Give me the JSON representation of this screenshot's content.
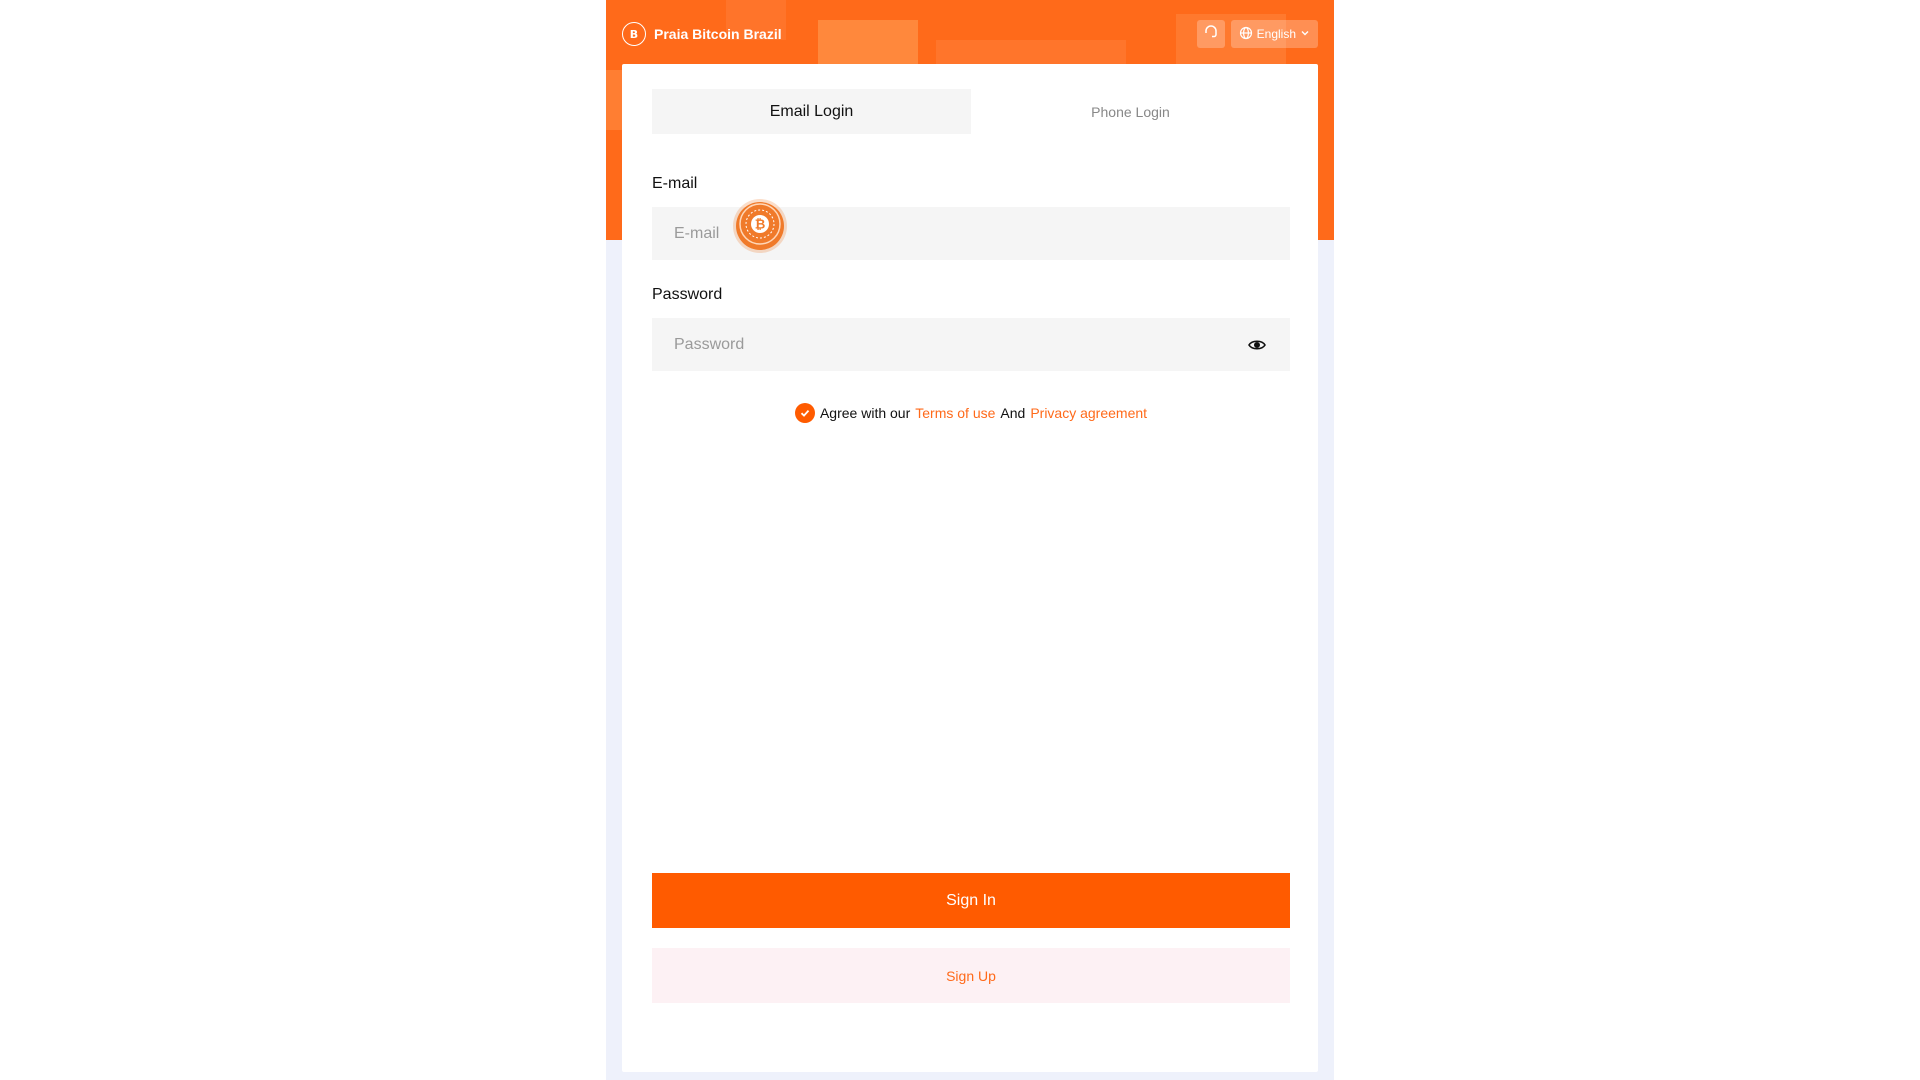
{
  "header": {
    "brand_name": "Praia Bitcoin Brazil",
    "brand_icon": "bitcoin-logo-icon",
    "support_icon": "headset-icon",
    "language_icon": "globe-icon",
    "language_label": "English",
    "language_chevron": "chevron-down-icon"
  },
  "tabs": [
    {
      "label": "Email Login",
      "active": true
    },
    {
      "label": "Phone Login",
      "active": false
    }
  ],
  "form": {
    "email_label": "E-mail",
    "email_placeholder": "E-mail",
    "email_value": "",
    "password_label": "Password",
    "password_placeholder": "Password",
    "password_value": "",
    "password_toggle_icon": "eye-icon"
  },
  "agreement": {
    "checked": true,
    "prefix": "Agree with our",
    "terms_label": "Terms of use",
    "conjunction": "And",
    "privacy_label": "Privacy agreement"
  },
  "actions": {
    "sign_in_label": "Sign In",
    "sign_up_label": "Sign Up"
  },
  "colors": {
    "accent": "#ff5b00",
    "hero": "#ff6a1a",
    "page_bg": "#eef1fb",
    "signup_bg": "#fdf1f4"
  }
}
